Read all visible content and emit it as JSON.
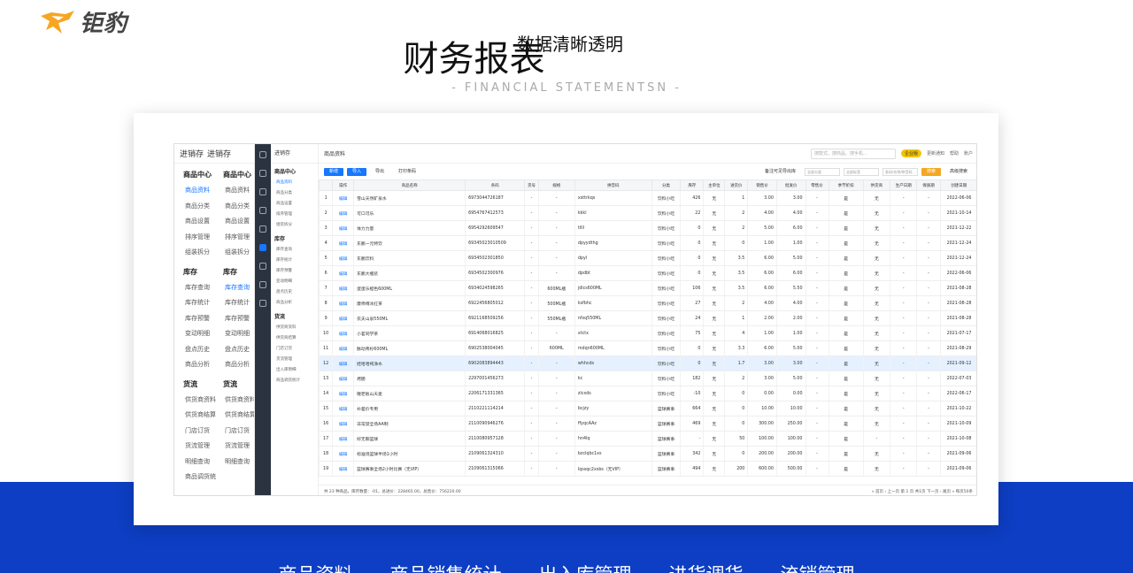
{
  "brand": {
    "name": "钜豹",
    "accent": "#f5a623",
    "blue": "#0d3ec3"
  },
  "hero": {
    "title": "财务报表",
    "subtitle": "数据清晰透明",
    "english": "- FINANCIAL STATEMENTSN -"
  },
  "bottom_nav": [
    "商品资料",
    "商品销售统计",
    "出入库管理",
    "进货调货",
    "流销管理"
  ],
  "app": {
    "nav1": {
      "head": [
        "进销存",
        "进销存"
      ],
      "col_a": [
        {
          "t": "grp",
          "v": "商品中心"
        },
        {
          "t": "it",
          "v": "商品资料",
          "active": true
        },
        {
          "t": "it",
          "v": "商品分类"
        },
        {
          "t": "it",
          "v": "商品设置"
        },
        {
          "t": "it",
          "v": "排序管理"
        },
        {
          "t": "it",
          "v": "组装拆分"
        },
        {
          "t": "grp",
          "v": "库存"
        },
        {
          "t": "it",
          "v": "库存查询"
        },
        {
          "t": "it",
          "v": "库存统计"
        },
        {
          "t": "it",
          "v": "库存预警"
        },
        {
          "t": "it",
          "v": "变动明细"
        },
        {
          "t": "it",
          "v": "盘点历史"
        },
        {
          "t": "it",
          "v": "商品分析"
        },
        {
          "t": "grp",
          "v": "货流"
        },
        {
          "t": "it",
          "v": "供货商资料"
        },
        {
          "t": "it",
          "v": "供货商结算"
        },
        {
          "t": "it",
          "v": "门店订货"
        },
        {
          "t": "it",
          "v": "货流管理"
        },
        {
          "t": "it",
          "v": "明细查询"
        },
        {
          "t": "it",
          "v": "商品调货统"
        }
      ],
      "col_b": [
        {
          "t": "grp",
          "v": "商品中心"
        },
        {
          "t": "it",
          "v": "商品资料"
        },
        {
          "t": "it",
          "v": "商品分类"
        },
        {
          "t": "it",
          "v": "商品设置"
        },
        {
          "t": "it",
          "v": "排序管理"
        },
        {
          "t": "it",
          "v": "组装拆分"
        },
        {
          "t": "grp",
          "v": "库存"
        },
        {
          "t": "it",
          "v": "库存查询",
          "active": true
        },
        {
          "t": "it",
          "v": "库存统计"
        },
        {
          "t": "it",
          "v": "库存预警"
        },
        {
          "t": "it",
          "v": "变动明细"
        },
        {
          "t": "it",
          "v": "盘点历史"
        },
        {
          "t": "it",
          "v": "商品分析"
        },
        {
          "t": "grp",
          "v": "货流"
        },
        {
          "t": "it",
          "v": "供货商资料"
        },
        {
          "t": "it",
          "v": "供货商结算"
        },
        {
          "t": "it",
          "v": "门店订货"
        },
        {
          "t": "it",
          "v": "货流管理"
        },
        {
          "t": "it",
          "v": "明细查询"
        }
      ]
    },
    "nav2": {
      "head": "进销存",
      "items": [
        {
          "t": "grp",
          "v": "商品中心"
        },
        {
          "t": "it",
          "v": "商品资料",
          "active": true
        },
        {
          "t": "it",
          "v": "商品分类"
        },
        {
          "t": "it",
          "v": "商品设置"
        },
        {
          "t": "it",
          "v": "排序管理"
        },
        {
          "t": "it",
          "v": "组装拆分"
        },
        {
          "t": "grp",
          "v": "库存"
        },
        {
          "t": "it",
          "v": "库存查询"
        },
        {
          "t": "it",
          "v": "库存统计"
        },
        {
          "t": "it",
          "v": "库存预警"
        },
        {
          "t": "it",
          "v": "变动明细"
        },
        {
          "t": "it",
          "v": "盘点历史"
        },
        {
          "t": "it",
          "v": "商品分析"
        },
        {
          "t": "grp",
          "v": "货流"
        },
        {
          "t": "it",
          "v": "供货商资料"
        },
        {
          "t": "it",
          "v": "供货商结算"
        },
        {
          "t": "it",
          "v": "门店订货"
        },
        {
          "t": "it",
          "v": "货流管理"
        },
        {
          "t": "it",
          "v": "出入库明细"
        },
        {
          "t": "it",
          "v": "商品调货统计"
        }
      ]
    },
    "topbar": {
      "crumb": "商品资料",
      "search_placeholder": "搜款式、搜商品、搜手机...",
      "badge": "企业版",
      "links": [
        "更新通知",
        "帮助",
        "账户"
      ]
    },
    "toolbar": {
      "new": "新增",
      "import": "导入",
      "export": "导出",
      "print": "打印条码",
      "filter_cb": "备注可见导出库",
      "sel1": "全部分类",
      "sel2": "全部标签",
      "search": "条码/名称/拼音码",
      "search_btn": "搜索",
      "adv": "高级搜索"
    },
    "columns": [
      "",
      "操作",
      "商品名称",
      "条码",
      "货号",
      "规格",
      "拼音码",
      "分类",
      "库存",
      "主单位",
      "进货价",
      "销售价",
      "批发价",
      "零售价",
      "季节折扣",
      "供货商",
      "生产日期",
      "保质期",
      "创建日期"
    ],
    "rows": [
      [
        "1",
        "编辑",
        "雪山天然矿泉水",
        "6973044726187",
        "-",
        "-",
        "xsttrkqs",
        "饮料小吃",
        "426",
        "无",
        "1",
        "3.00",
        "3.00",
        "-",
        "是",
        "无",
        "-",
        "-",
        "2022-06-06"
      ],
      [
        "2",
        "编辑",
        "可口可乐",
        "6954767412573",
        "-",
        "-",
        "kkkl",
        "饮料小吃",
        "22",
        "无",
        "2",
        "4.00",
        "4.00",
        "-",
        "是",
        "无",
        "-",
        "-",
        "2021-10-14"
      ],
      [
        "3",
        "编辑",
        "体力力量",
        "6954292609547",
        "-",
        "-",
        "tllll",
        "饮料小吃",
        "0",
        "无",
        "2",
        "5.00",
        "6.00",
        "-",
        "是",
        "无",
        "-",
        "-",
        "2021-12-22"
      ],
      [
        "4",
        "编辑",
        "东鹏一元特饮",
        "69345023010509",
        "-",
        "-",
        "dpyydthg",
        "饮料小吃",
        "0",
        "无",
        "0",
        "1.00",
        "1.00",
        "-",
        "是",
        "无",
        "-",
        "-",
        "2021-12-24"
      ],
      [
        "5",
        "编辑",
        "东鹏饮料",
        "6934502301850",
        "-",
        "-",
        "dpyl",
        "饮料小吃",
        "0",
        "无",
        "3.5",
        "6.00",
        "5.00",
        "-",
        "是",
        "无",
        "-",
        "-",
        "2021-12-24"
      ],
      [
        "6",
        "编辑",
        "东鹏大瓶装",
        "6934502300976",
        "-",
        "-",
        "dpdbt",
        "饮料小吃",
        "0",
        "无",
        "3.5",
        "6.00",
        "6.00",
        "-",
        "是",
        "无",
        "-",
        "-",
        "2022-06-06"
      ],
      [
        "7",
        "编辑",
        "蛋蛋乐橙色600ML",
        "6934024598265",
        "-",
        "600ML瓶",
        "jdlcs600ML",
        "饮料小吃",
        "106",
        "无",
        "3.5",
        "6.00",
        "5.50",
        "-",
        "是",
        "无",
        "-",
        "-",
        "2021-08-28"
      ],
      [
        "8",
        "编辑",
        "康师傅冰红茶",
        "6922456805012",
        "-",
        "500ML瓶",
        "ksfbhc",
        "饮料小吃",
        "27",
        "无",
        "2",
        "4.00",
        "4.00",
        "-",
        "是",
        "无",
        "-",
        "-",
        "2021-08-28"
      ],
      [
        "9",
        "编辑",
        "农夫山泉550ML",
        "6921168509256",
        "-",
        "550ML瓶",
        "nfsq550ML",
        "饮料小吃",
        "24",
        "无",
        "1",
        "2.00",
        "2.00",
        "-",
        "是",
        "无",
        "-",
        "-",
        "2021-08-28"
      ],
      [
        "10",
        "编辑",
        "小茗同学茶",
        "6914068016825",
        "-",
        "-",
        "xtctx",
        "饮料小吃",
        "75",
        "无",
        "4",
        "1.00",
        "1.00",
        "-",
        "是",
        "无",
        "-",
        "-",
        "2021-07-17"
      ],
      [
        "11",
        "编辑",
        "脉动青柠600ML",
        "6902538004045",
        "-",
        "600ML",
        "mdqn600ML",
        "饮料小吃",
        "0",
        "无",
        "3.3",
        "6.00",
        "5.00",
        "-",
        "是",
        "无",
        "-",
        "-",
        "2021-08-29"
      ],
      [
        "12",
        "编辑",
        "娃哈哈纯净水",
        "6902083894443",
        "-",
        "-",
        "whhcds",
        "饮料小吃",
        "0",
        "无",
        "1.7",
        "3.00",
        "3.00",
        "-",
        "是",
        "无",
        "-",
        "-",
        "2021-09-12"
      ],
      [
        "13",
        "编辑",
        "烤肠",
        "2297001456273",
        "-",
        "-",
        "kc",
        "饮料小吃",
        "182",
        "无",
        "2",
        "3.00",
        "5.00",
        "-",
        "是",
        "无",
        "-",
        "-",
        "2022-07-03"
      ],
      [
        "14",
        "编辑",
        "喔老板山天麦",
        "2206171331365",
        "-",
        "-",
        "zlcxds",
        "饮料小吃",
        "-10",
        "无",
        "0",
        "0.00",
        "0.00",
        "-",
        "是",
        "无",
        "-",
        "-",
        "2022-06-17"
      ],
      [
        "15",
        "编辑",
        "补差价专用",
        "2110221114214",
        "-",
        "-",
        "bcjzy",
        "篮球赛事",
        "664",
        "无",
        "0",
        "10.00",
        "10.00",
        "-",
        "是",
        "无",
        "-",
        "-",
        "2021-10-22"
      ],
      [
        "16",
        "编辑",
        "非常禁全场AA制",
        "2110090946276",
        "-",
        "-",
        "ffyqcAAz",
        "篮球赛事",
        "469",
        "无",
        "0",
        "300.00",
        "250.00",
        "-",
        "是",
        "无",
        "-",
        "-",
        "2021-10-09"
      ],
      [
        "17",
        "编辑",
        "好无聊篮球",
        "2110080957128",
        "-",
        "-",
        "hn4lq",
        "篮球赛事",
        "-",
        "无",
        "50",
        "100.00",
        "100.00",
        "-",
        "是",
        "-",
        "-",
        "-",
        "2021-10-08"
      ],
      [
        "18",
        "编辑",
        "标准场篮球半场1小时",
        "2109061324310",
        "-",
        "-",
        "bzclqbc1xs",
        "篮球赛事",
        "342",
        "无",
        "0",
        "200.00",
        "200.00",
        "-",
        "是",
        "无",
        "-",
        "-",
        "2021-09-06"
      ],
      [
        "19",
        "编辑",
        "篮球赛事全场2小时比赛（无VIP）",
        "2109061315066",
        "-",
        "-",
        "lqssqc2xsbs（无VIP）",
        "篮球赛事",
        "494",
        "无",
        "200",
        "600.00",
        "500.00",
        "-",
        "是",
        "无",
        "-",
        "-",
        "2021-09-06"
      ]
    ],
    "footer": {
      "summary": "共 23 种商品，库存数量：-01，总进价：228465.00，总售价：756220.00",
      "pager": "« 首页  ‹ 上一页  第 1 页  共1页  下一页 ›  尾页 »  每页50条"
    }
  }
}
